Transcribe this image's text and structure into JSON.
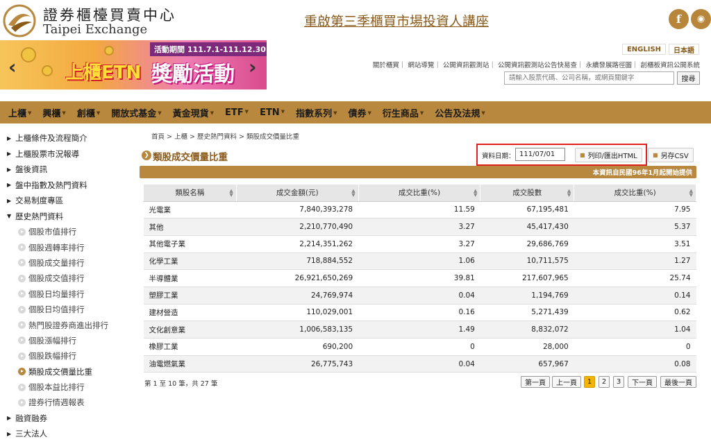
{
  "header": {
    "logo_cn": "證券櫃檯買賣中心",
    "logo_en": "Taipei Exchange",
    "headline": "重啟第三季櫃買市場投資人講座",
    "social": [
      {
        "icon": "facebook-icon",
        "label": "f"
      },
      {
        "icon": "rss-icon",
        "label": "◉"
      }
    ]
  },
  "banner": {
    "period": "活動期間 111.7.1-111.12.30",
    "title_part1": "上櫃ETN",
    "title_part2": "獎勵活動"
  },
  "lang": {
    "english": "ENGLISH",
    "japanese": "日本語"
  },
  "toplinks": "關於櫃買｜ 網站導覽｜ 公開資訊觀測站｜ 公開資訊觀測站公告快易查｜ 永續發展路徑圖｜ 創櫃板資訊公開系統",
  "search": {
    "placeholder": "請輸入股票代碼、公司名稱，或網頁關鍵字",
    "button": "搜尋"
  },
  "nav": [
    "上櫃",
    "興櫃",
    "創櫃",
    "開放式基金",
    "黃金現貨",
    "ETF",
    "ETN",
    "指數系列",
    "債券",
    "衍生商品",
    "公告及法規"
  ],
  "sidebar": {
    "top": [
      "上櫃條件及流程簡介",
      "上櫃股票市況報導",
      "盤後資訊",
      "盤中指數及熱門資料",
      "交易制度專區"
    ],
    "expanded": "歷史熱門資料",
    "sub": [
      "個股市值排行",
      "個股週轉率排行",
      "個股成交量排行",
      "個股成交值排行",
      "個股日均量排行",
      "個股日均值排行",
      "熱門股證券商進出排行",
      "個股漲幅排行",
      "個股跌幅排行",
      "類股成交價量比重",
      "個股本益比排行",
      "證券行情週報表"
    ],
    "bottom": [
      "融資融券",
      "三大法人"
    ]
  },
  "breadcrumb": "首頁 > 上櫃 > 歷史熱門資料 > 類股成交價量比重",
  "page_title": "類股成交價量比重",
  "toolbar": {
    "date_label": "資料日期：",
    "date_value": "111/07/01",
    "print_label": "列印/匯出HTML",
    "csv_label": "另存CSV"
  },
  "info_bar": "本資訊自民國96年1月起開始提供",
  "table": {
    "headers": [
      "類股名稱",
      "成交金額(元)",
      "成交比重(%)",
      "成交股數",
      "成交比重(%)"
    ],
    "rows": [
      [
        "光電業",
        "7,840,393,278",
        "11.59",
        "67,195,481",
        "7.95"
      ],
      [
        "其他",
        "2,210,770,490",
        "3.27",
        "45,417,430",
        "5.37"
      ],
      [
        "其他電子業",
        "2,214,351,262",
        "3.27",
        "29,686,769",
        "3.51"
      ],
      [
        "化學工業",
        "718,884,552",
        "1.06",
        "10,711,575",
        "1.27"
      ],
      [
        "半導體業",
        "26,921,650,269",
        "39.81",
        "217,607,965",
        "25.74"
      ],
      [
        "塑膠工業",
        "24,769,974",
        "0.04",
        "1,194,769",
        "0.14"
      ],
      [
        "建材營造",
        "110,029,001",
        "0.16",
        "5,271,439",
        "0.62"
      ],
      [
        "文化創意業",
        "1,006,583,135",
        "1.49",
        "8,832,072",
        "1.04"
      ],
      [
        "橡膠工業",
        "690,200",
        "0",
        "28,000",
        "0"
      ],
      [
        "油電燃氣業",
        "26,775,743",
        "0.04",
        "657,967",
        "0.08"
      ]
    ]
  },
  "record_info": "第 1 至 10 筆，共 27 筆",
  "pagination": {
    "first": "第一頁",
    "prev": "上一頁",
    "pages": [
      "1",
      "2",
      "3"
    ],
    "next": "下一頁",
    "last": "最後一頁"
  }
}
